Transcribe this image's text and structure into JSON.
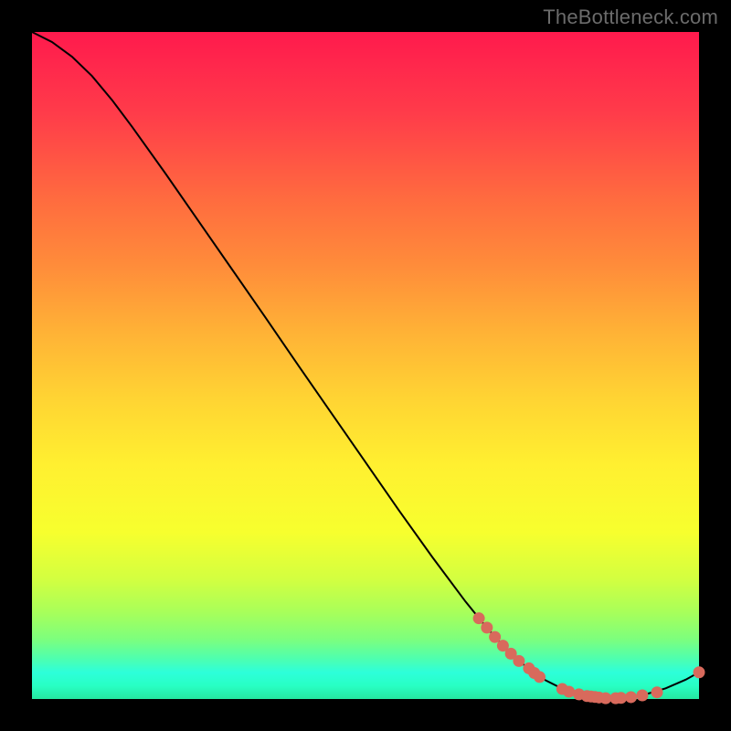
{
  "watermark": "TheBottleneck.com",
  "colors": {
    "point": "#d86a5c",
    "line": "#000000"
  },
  "chart_data": {
    "type": "line",
    "title": "",
    "xlabel": "",
    "ylabel": "",
    "xlim": [
      0,
      100
    ],
    "ylim": [
      0,
      100
    ],
    "grid": false,
    "legend": false,
    "curve": [
      {
        "x": 0,
        "y": 100
      },
      {
        "x": 3,
        "y": 98.5
      },
      {
        "x": 6,
        "y": 96.3
      },
      {
        "x": 9,
        "y": 93.4
      },
      {
        "x": 12,
        "y": 89.8
      },
      {
        "x": 15,
        "y": 85.8
      },
      {
        "x": 20,
        "y": 78.8
      },
      {
        "x": 25,
        "y": 71.6
      },
      {
        "x": 30,
        "y": 64.4
      },
      {
        "x": 35,
        "y": 57.2
      },
      {
        "x": 40,
        "y": 49.9
      },
      {
        "x": 45,
        "y": 42.7
      },
      {
        "x": 50,
        "y": 35.5
      },
      {
        "x": 55,
        "y": 28.3
      },
      {
        "x": 60,
        "y": 21.3
      },
      {
        "x": 65,
        "y": 14.6
      },
      {
        "x": 68,
        "y": 10.9
      },
      {
        "x": 71,
        "y": 7.6
      },
      {
        "x": 74,
        "y": 4.9
      },
      {
        "x": 77,
        "y": 2.8
      },
      {
        "x": 80,
        "y": 1.3
      },
      {
        "x": 83,
        "y": 0.45
      },
      {
        "x": 86,
        "y": 0.1
      },
      {
        "x": 89,
        "y": 0.2
      },
      {
        "x": 92,
        "y": 0.7
      },
      {
        "x": 95,
        "y": 1.6
      },
      {
        "x": 98,
        "y": 2.9
      },
      {
        "x": 100,
        "y": 4.0
      }
    ],
    "points": [
      {
        "x": 67.0,
        "y": 12.1
      },
      {
        "x": 68.2,
        "y": 10.7
      },
      {
        "x": 69.4,
        "y": 9.3
      },
      {
        "x": 70.6,
        "y": 8.0
      },
      {
        "x": 71.8,
        "y": 6.8
      },
      {
        "x": 73.0,
        "y": 5.7
      },
      {
        "x": 74.5,
        "y": 4.6
      },
      {
        "x": 75.3,
        "y": 3.9
      },
      {
        "x": 76.1,
        "y": 3.3
      },
      {
        "x": 79.5,
        "y": 1.5
      },
      {
        "x": 80.5,
        "y": 1.1
      },
      {
        "x": 82.0,
        "y": 0.7
      },
      {
        "x": 83.2,
        "y": 0.45
      },
      {
        "x": 83.8,
        "y": 0.38
      },
      {
        "x": 84.4,
        "y": 0.3
      },
      {
        "x": 85.0,
        "y": 0.23
      },
      {
        "x": 86.0,
        "y": 0.12
      },
      {
        "x": 87.5,
        "y": 0.12
      },
      {
        "x": 88.3,
        "y": 0.17
      },
      {
        "x": 89.8,
        "y": 0.28
      },
      {
        "x": 91.5,
        "y": 0.55
      },
      {
        "x": 93.7,
        "y": 1.0
      },
      {
        "x": 100.0,
        "y": 4.0
      }
    ]
  }
}
